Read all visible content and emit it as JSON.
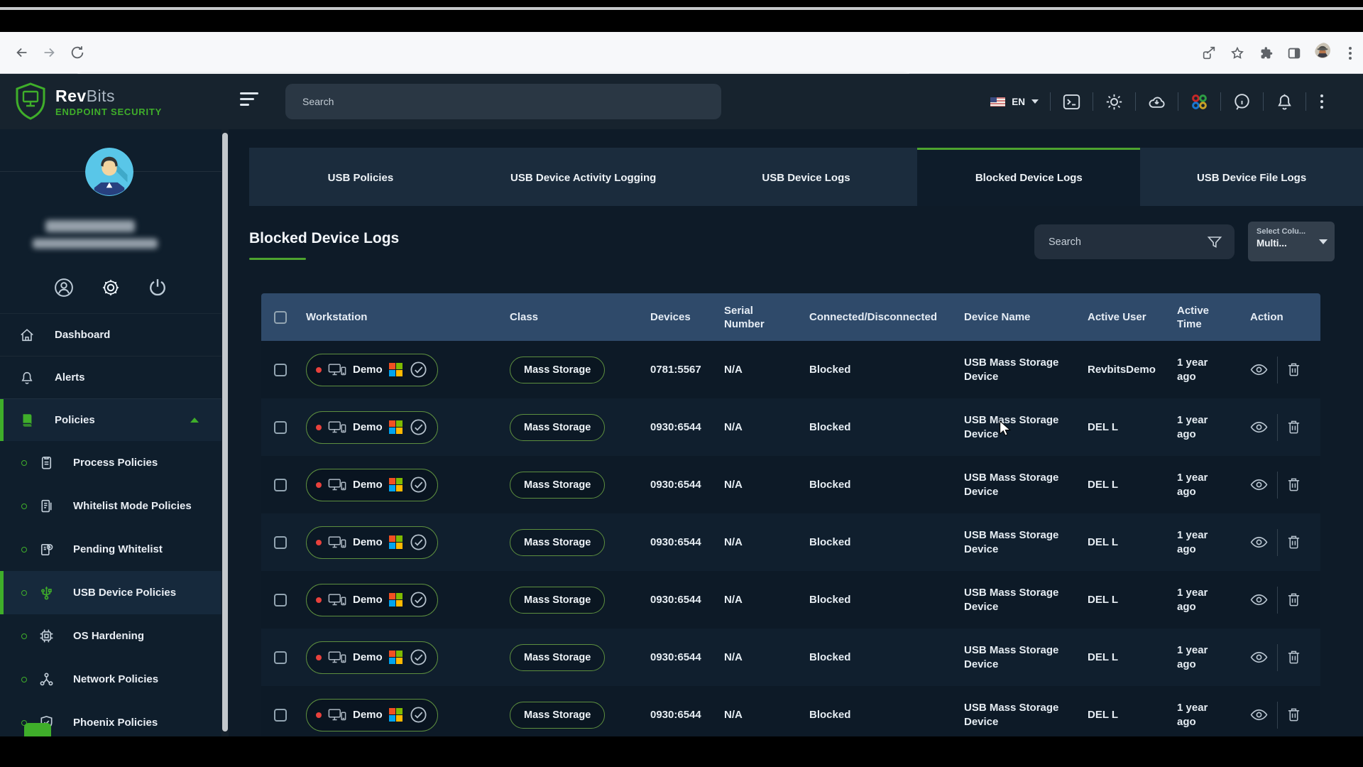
{
  "app_header": {
    "brand": {
      "bold": "Rev",
      "light": "Bits",
      "tagline": "ENDPOINT SECURITY"
    },
    "search_placeholder": "Search",
    "language": "EN"
  },
  "sidebar": {
    "items": [
      {
        "icon": "home",
        "label": "Dashboard"
      },
      {
        "icon": "bell",
        "label": "Alerts"
      },
      {
        "icon": "policies",
        "label": "Policies",
        "active": true,
        "expanded": true,
        "children": [
          {
            "icon": "process",
            "label": "Process Policies"
          },
          {
            "icon": "whitelist",
            "label": "Whitelist Mode Policies"
          },
          {
            "icon": "pending",
            "label": "Pending Whitelist"
          },
          {
            "icon": "usb",
            "label": "USB Device Policies",
            "active": true
          },
          {
            "icon": "os",
            "label": "OS Hardening"
          },
          {
            "icon": "network",
            "label": "Network Policies"
          },
          {
            "icon": "phoenix",
            "label": "Phoenix Policies"
          }
        ]
      }
    ]
  },
  "tabs": {
    "active_index": 3,
    "items": [
      "USB Policies",
      "USB Device Activity Logging",
      "USB Device Logs",
      "Blocked Device Logs",
      "USB Device File Logs"
    ]
  },
  "page": {
    "title": "Blocked Device Logs",
    "filter_placeholder": "Search",
    "select_columns": {
      "label": "Select Colu...",
      "value": "Multi..."
    }
  },
  "table": {
    "columns": [
      "Workstation",
      "Class",
      "Devices",
      "Serial Number",
      "Connected/Disconnected",
      "Device Name",
      "Active User",
      "Active Time",
      "Action"
    ],
    "rows": [
      {
        "workstation": "Demo",
        "class": "Mass Storage",
        "devices": "0781:5567",
        "serial": "N/A",
        "status": "Blocked",
        "device_name": "USB Mass Storage Device",
        "active_user": "RevbitsDemo",
        "active_time": "1 year ago"
      },
      {
        "workstation": "Demo",
        "class": "Mass Storage",
        "devices": "0930:6544",
        "serial": "N/A",
        "status": "Blocked",
        "device_name": "USB Mass Storage Device",
        "active_user": "DEL L",
        "active_time": "1 year ago"
      },
      {
        "workstation": "Demo",
        "class": "Mass Storage",
        "devices": "0930:6544",
        "serial": "N/A",
        "status": "Blocked",
        "device_name": "USB Mass Storage Device",
        "active_user": "DEL L",
        "active_time": "1 year ago"
      },
      {
        "workstation": "Demo",
        "class": "Mass Storage",
        "devices": "0930:6544",
        "serial": "N/A",
        "status": "Blocked",
        "device_name": "USB Mass Storage Device",
        "active_user": "DEL L",
        "active_time": "1 year ago"
      },
      {
        "workstation": "Demo",
        "class": "Mass Storage",
        "devices": "0930:6544",
        "serial": "N/A",
        "status": "Blocked",
        "device_name": "USB Mass Storage Device",
        "active_user": "DEL L",
        "active_time": "1 year ago"
      },
      {
        "workstation": "Demo",
        "class": "Mass Storage",
        "devices": "0930:6544",
        "serial": "N/A",
        "status": "Blocked",
        "device_name": "USB Mass Storage Device",
        "active_user": "DEL L",
        "active_time": "1 year ago"
      },
      {
        "workstation": "Demo",
        "class": "Mass Storage",
        "devices": "0930:6544",
        "serial": "N/A",
        "status": "Blocked",
        "device_name": "USB Mass Storage Device",
        "active_user": "DEL L",
        "active_time": "1 year ago"
      }
    ]
  },
  "colors": {
    "accent_green": "#3fae2a",
    "pill_border": "#5d8f3f",
    "table_header": "#2f4a6a",
    "windows_logo": [
      "#f25022",
      "#7fba00",
      "#00a4ef",
      "#ffb900"
    ],
    "apps_icon": [
      "#c62828",
      "#2e9e44",
      "#1976d2",
      "#c9a227"
    ]
  }
}
